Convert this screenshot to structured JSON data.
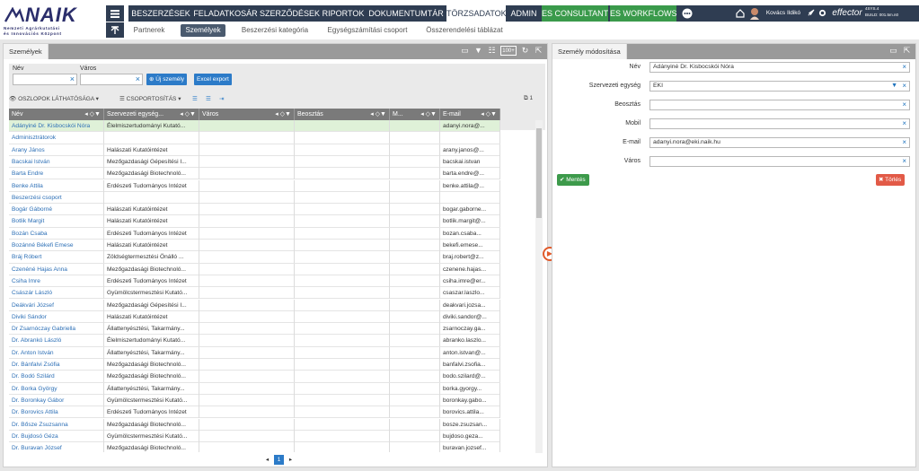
{
  "header": {
    "logo_text": "NAIK",
    "logo_sub1": "Nemzeti Agrárkutatási",
    "logo_sub2": "és Innovációs Központ",
    "nav": [
      {
        "label": "BESZERZÉSEK"
      },
      {
        "label": "FELADATKOSÁR"
      },
      {
        "label": "SZERZŐDÉSEK"
      },
      {
        "label": "RIPORTOK"
      },
      {
        "label": "DOKUMENTUMTÁR"
      },
      {
        "label": "TÖRZSADATOK",
        "selected": true
      },
      {
        "label": "ADMIN"
      },
      {
        "label": "ES CONSULTANT",
        "accent": true
      },
      {
        "label": "ES WORKFLOWS",
        "accent": true
      }
    ],
    "user_name": "Kovács Ildikó",
    "brand": "effector",
    "version": "4SYS.4",
    "build": "BUILD: 001.5m.n0"
  },
  "subnav": [
    {
      "label": "Partnerek"
    },
    {
      "label": "Személyek",
      "selected": true
    },
    {
      "label": "Beszerzési kategória"
    },
    {
      "label": "Egységszámítási csoport"
    },
    {
      "label": "Összerendelési táblázat"
    }
  ],
  "left_panel": {
    "tab": "Személyek",
    "filter": {
      "name_label": "Név",
      "city_label": "Város",
      "name_value": "",
      "city_value": ""
    },
    "new_person_button": "Új személy",
    "excel_button": "Excel export",
    "columns_visibility": "OSZLOPOK LÁTHATÓSÁGA",
    "grouping": "CSOPORTOSÍTÁS",
    "badge_count": "1",
    "columns": [
      "Név",
      "Szervezeti egység...",
      "Város",
      "Beosztás",
      "M...",
      "E-mail"
    ],
    "rows": [
      [
        "Adányiné Dr. Kisbocskói Nóra",
        "Élelmiszertudományi Kutató...",
        "",
        "",
        "",
        "adanyi.nora@..."
      ],
      [
        "Adminisztrátorok",
        "",
        "",
        "",
        "",
        ""
      ],
      [
        "Arany János",
        "Halászati Kutatóintézet",
        "",
        "",
        "",
        "arany.janos@..."
      ],
      [
        "Bacskai István",
        "Mezőgazdasági Gépesítési I...",
        "",
        "",
        "",
        "bacskai.istvan"
      ],
      [
        "Barta Endre",
        "Mezőgazdasági Biotechnoló...",
        "",
        "",
        "",
        "barta.endre@..."
      ],
      [
        "Benke Attila",
        "Erdészeti Tudományos Intézet",
        "",
        "",
        "",
        "benke.attila@..."
      ],
      [
        "Beszerzési csoport",
        "",
        "",
        "",
        "",
        ""
      ],
      [
        "Bogár Gáborné",
        "Halászati Kutatóintézet",
        "",
        "",
        "",
        "bogar.gaborne..."
      ],
      [
        "Botlik Margit",
        "Halászati Kutatóintézet",
        "",
        "",
        "",
        "botlik.margit@..."
      ],
      [
        "Bozán Csaba",
        "Erdészeti Tudományos Intézet",
        "",
        "",
        "",
        "bozan.csaba..."
      ],
      [
        "Bozánné Békefi Emese",
        "Halászati Kutatóintézet",
        "",
        "",
        "",
        "bekefi.emese..."
      ],
      [
        "Bráj Róbert",
        "Zöldségtermesztési Önálló ...",
        "",
        "",
        "",
        "braj.robert@z..."
      ],
      [
        "Czenéné Hajas Anna",
        "Mezőgazdasági Biotechnoló...",
        "",
        "",
        "",
        "czenene.hajas..."
      ],
      [
        "Csiha Imre",
        "Erdészeti Tudományos Intézet",
        "",
        "",
        "",
        "csiha.imre@er..."
      ],
      [
        "Császár László",
        "Gyümölcstermesztési Kutató...",
        "",
        "",
        "",
        "csaszar.laszlo..."
      ],
      [
        "Deákvári József",
        "Mezőgazdasági Gépesítési I...",
        "",
        "",
        "",
        "deakvari.jozsa..."
      ],
      [
        "Diviki Sándor",
        "Halászati Kutatóintézet",
        "",
        "",
        "",
        "diviki.sandor@..."
      ],
      [
        "Dr Zsarnóczay Gabriella",
        "Állattenyésztési, Takarmány...",
        "",
        "",
        "",
        "zsarnoczay.ga..."
      ],
      [
        "Dr. Abrankó László",
        "Élelmiszertudományi Kutató...",
        "",
        "",
        "",
        "abranko.laszlo..."
      ],
      [
        "Dr. Anton István",
        "Állattenyésztési, Takarmány...",
        "",
        "",
        "",
        "anton.istvan@..."
      ],
      [
        "Dr. Bánfalvi Zsófia",
        "Mezőgazdasági Biotechnoló...",
        "",
        "",
        "",
        "banfalvi.zsofia..."
      ],
      [
        "Dr. Bodó Szilárd",
        "Mezőgazdasági Biotechnoló...",
        "",
        "",
        "",
        "bodo.szilard@..."
      ],
      [
        "Dr. Borka György",
        "Állattenyésztési, Takarmány...",
        "",
        "",
        "",
        "borka.gyorgy..."
      ],
      [
        "Dr. Boronkay Gábor",
        "Gyümölcstermesztési Kutató...",
        "",
        "",
        "",
        "boronkay.gabo..."
      ],
      [
        "Dr. Borovics Attila",
        "Erdészeti Tudományos Intézet",
        "",
        "",
        "",
        "borovics.attila..."
      ],
      [
        "Dr. Bősze Zsuzsanna",
        "Mezőgazdasági Biotechnoló...",
        "",
        "",
        "",
        "bosze.zsuzsan..."
      ],
      [
        "Dr. Bujdosó Géza",
        "Gyümölcstermesztési Kutató...",
        "",
        "",
        "",
        "bujdoso.geza..."
      ],
      [
        "Dr. Buravan József",
        "Mezőgazdasági Biotechnoló...",
        "",
        "",
        "",
        "buravan.jozsef..."
      ]
    ],
    "page": "1"
  },
  "right_panel": {
    "title": "Személy módosítása",
    "fields": {
      "name_label": "Név",
      "name_value": "Adányiné Dr. Kisbocskói Nóra",
      "org_label": "Szervezeti egység",
      "org_value": "EKI",
      "position_label": "Beosztás",
      "position_value": "",
      "mobile_label": "Mobil",
      "mobile_value": "",
      "email_label": "E-mail",
      "email_value": "adanyi.nora@eki.naik.hu",
      "city_label": "Város",
      "city_value": ""
    },
    "save_button": "Mentés",
    "delete_button": "Törlés"
  }
}
